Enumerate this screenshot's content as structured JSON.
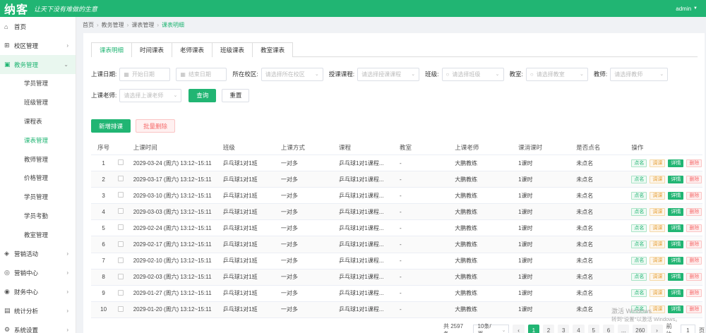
{
  "header": {
    "logo": "纳客",
    "slogan": "让天下没有难做的生意",
    "user": "admin",
    "user_caret": "▼"
  },
  "sidebar": {
    "items": [
      {
        "label": "首页",
        "icon": "⌂",
        "arrow": ""
      },
      {
        "label": "校区管理",
        "icon": "⊞",
        "arrow": "›"
      },
      {
        "label": "教务管理",
        "icon": "▣",
        "arrow": "⌄"
      }
    ],
    "sub_items": [
      {
        "label": "学员管理"
      },
      {
        "label": "班级管理"
      },
      {
        "label": "课程表"
      },
      {
        "label": "课表管理"
      },
      {
        "label": "教师管理"
      },
      {
        "label": "价格管理"
      },
      {
        "label": "学员管理"
      },
      {
        "label": "学员考勤"
      },
      {
        "label": "教室管理"
      }
    ],
    "bottom_items": [
      {
        "label": "营销活动",
        "icon": "◈",
        "arrow": "›"
      },
      {
        "label": "营销中心",
        "icon": "◎",
        "arrow": "›"
      },
      {
        "label": "财务中心",
        "icon": "◉",
        "arrow": "›"
      },
      {
        "label": "统计分析",
        "icon": "▤",
        "arrow": "›"
      },
      {
        "label": "系统设置",
        "icon": "⚙",
        "arrow": "›"
      }
    ]
  },
  "breadcrumb": {
    "items": [
      "首页",
      "教务管理",
      "课表管理",
      "课表明细"
    ],
    "sep": "›"
  },
  "tabs": [
    "课表明细",
    "时间课表",
    "老师课表",
    "班级课表",
    "教室课表"
  ],
  "filters": {
    "date_label": "上课日期:",
    "start_placeholder": "开始日期",
    "end_placeholder": "结束日期",
    "campus_label": "所在校区:",
    "campus_placeholder": "请选择所在校区",
    "course_label": "授课课程:",
    "course_placeholder": "请选择授课课程",
    "class_label": "班级:",
    "class_placeholder": "请选择班级",
    "classroom_label": "教室:",
    "classroom_placeholder": "请选择教室",
    "teacher_label": "教师:",
    "teacher_placeholder": "请选择教师",
    "lecturer_label": "上课老师:",
    "lecturer_placeholder": "请选择上课老师",
    "query_button": "查询",
    "reset_button": "重置"
  },
  "actions": {
    "add_button": "新增排课",
    "batch_delete_button": "批量删除"
  },
  "table": {
    "headers": [
      "序号",
      "",
      "上课时间",
      "班级",
      "上课方式",
      "课程",
      "教室",
      "上课老师",
      "课消课时",
      "是否点名",
      "操作"
    ],
    "rows": [
      {
        "no": "1",
        "time": "2029-03-24 (周六) 13:12~15:11",
        "class": "乒乓球1对1班",
        "mode": "一对多",
        "course": "乒乓球1对1课程...",
        "room": "-",
        "teacher": "大鹏教练",
        "hours": "1课时",
        "called": "未点名"
      },
      {
        "no": "2",
        "time": "2029-03-17 (周六) 13:12~15:11",
        "class": "乒乓球1对1班",
        "mode": "一对多",
        "course": "乒乓球1对1课程...",
        "room": "-",
        "teacher": "大鹏教练",
        "hours": "1课时",
        "called": "未点名"
      },
      {
        "no": "3",
        "time": "2029-03-10 (周六) 13:12~15:11",
        "class": "乒乓球1对1班",
        "mode": "一对多",
        "course": "乒乓球1对1课程...",
        "room": "-",
        "teacher": "大鹏教练",
        "hours": "1课时",
        "called": "未点名"
      },
      {
        "no": "4",
        "time": "2029-03-03 (周六) 13:12~15:11",
        "class": "乒乓球1对1班",
        "mode": "一对多",
        "course": "乒乓球1对1课程...",
        "room": "-",
        "teacher": "大鹏教练",
        "hours": "1课时",
        "called": "未点名"
      },
      {
        "no": "5",
        "time": "2029-02-24 (周六) 13:12~15:11",
        "class": "乒乓球1对1班",
        "mode": "一对多",
        "course": "乒乓球1对1课程...",
        "room": "-",
        "teacher": "大鹏教练",
        "hours": "1课时",
        "called": "未点名"
      },
      {
        "no": "6",
        "time": "2029-02-17 (周六) 13:12~15:11",
        "class": "乒乓球1对1班",
        "mode": "一对多",
        "course": "乒乓球1对1课程...",
        "room": "-",
        "teacher": "大鹏教练",
        "hours": "1课时",
        "called": "未点名"
      },
      {
        "no": "7",
        "time": "2029-02-10 (周六) 13:12~15:11",
        "class": "乒乓球1对1班",
        "mode": "一对多",
        "course": "乒乓球1对1课程...",
        "room": "-",
        "teacher": "大鹏教练",
        "hours": "1课时",
        "called": "未点名"
      },
      {
        "no": "8",
        "time": "2029-02-03 (周六) 13:12~15:11",
        "class": "乒乓球1对1班",
        "mode": "一对多",
        "course": "乒乓球1对1课程...",
        "room": "-",
        "teacher": "大鹏教练",
        "hours": "1课时",
        "called": "未点名"
      },
      {
        "no": "9",
        "time": "2029-01-27 (周六) 13:12~15:11",
        "class": "乒乓球1对1班",
        "mode": "一对多",
        "course": "乒乓球1对1课程...",
        "room": "-",
        "teacher": "大鹏教练",
        "hours": "1课时",
        "called": "未点名"
      },
      {
        "no": "10",
        "time": "2029-01-20 (周六) 13:12~15:11",
        "class": "乒乓球1对1班",
        "mode": "一对多",
        "course": "乒乓球1对1课程...",
        "room": "-",
        "teacher": "大鹏教练",
        "hours": "1课时",
        "called": "未点名"
      }
    ],
    "ops": {
      "call": "点名",
      "adjust": "调课",
      "detail": "详情",
      "delete": "删除"
    }
  },
  "pagination": {
    "total": "共 2597 条",
    "page_size": "10条/页",
    "prev": "‹",
    "pages": [
      "1",
      "2",
      "3",
      "4",
      "5",
      "6",
      "..."
    ],
    "last": "260",
    "next": "›",
    "goto_label": "前往",
    "goto_value": "1",
    "goto_suffix": "页"
  },
  "watermark": {
    "line1": "激活 Windows",
    "line2": "转到\"设置\"以激活 Windows。"
  },
  "colors": {
    "brand": "#21b573",
    "danger": "#f56c6c",
    "warning": "#e6a23c"
  }
}
